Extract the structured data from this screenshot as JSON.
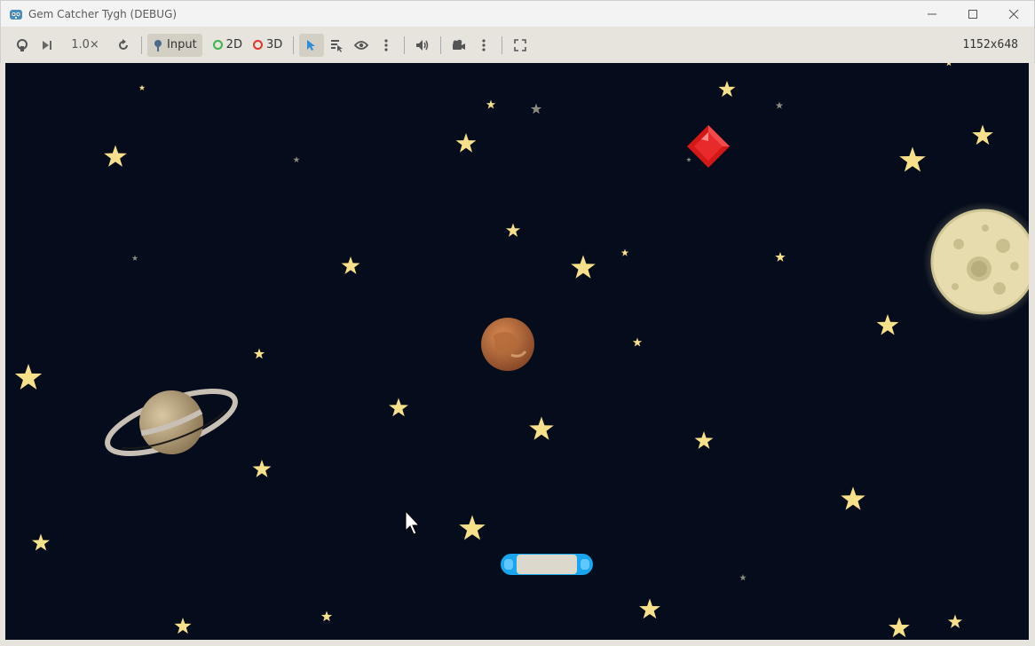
{
  "window": {
    "title": "Gem Catcher Tygh (DEBUG)",
    "minimize_icon": "minimize-icon",
    "maximize_icon": "maximize-icon",
    "close_icon": "close-icon"
  },
  "toolbar": {
    "speed_label": "1.0×",
    "input_label": "Input",
    "label_2d": "2D",
    "label_3d": "3D",
    "resolution": "1152x648",
    "colors": {
      "accent_2d": "#3cb54a",
      "accent_3d": "#e0352b",
      "select_active": "#2a8cdb"
    }
  },
  "scene": {
    "background_color": "#050c1b",
    "objects": [
      "saturn-planet",
      "mars-planet",
      "moon",
      "red-gem",
      "paddle",
      "stars"
    ],
    "colors": {
      "star": "#f7e08a",
      "gem": "#e02020",
      "paddle_edge": "#1aa6ee",
      "paddle_body": "#dcd8cc"
    }
  }
}
